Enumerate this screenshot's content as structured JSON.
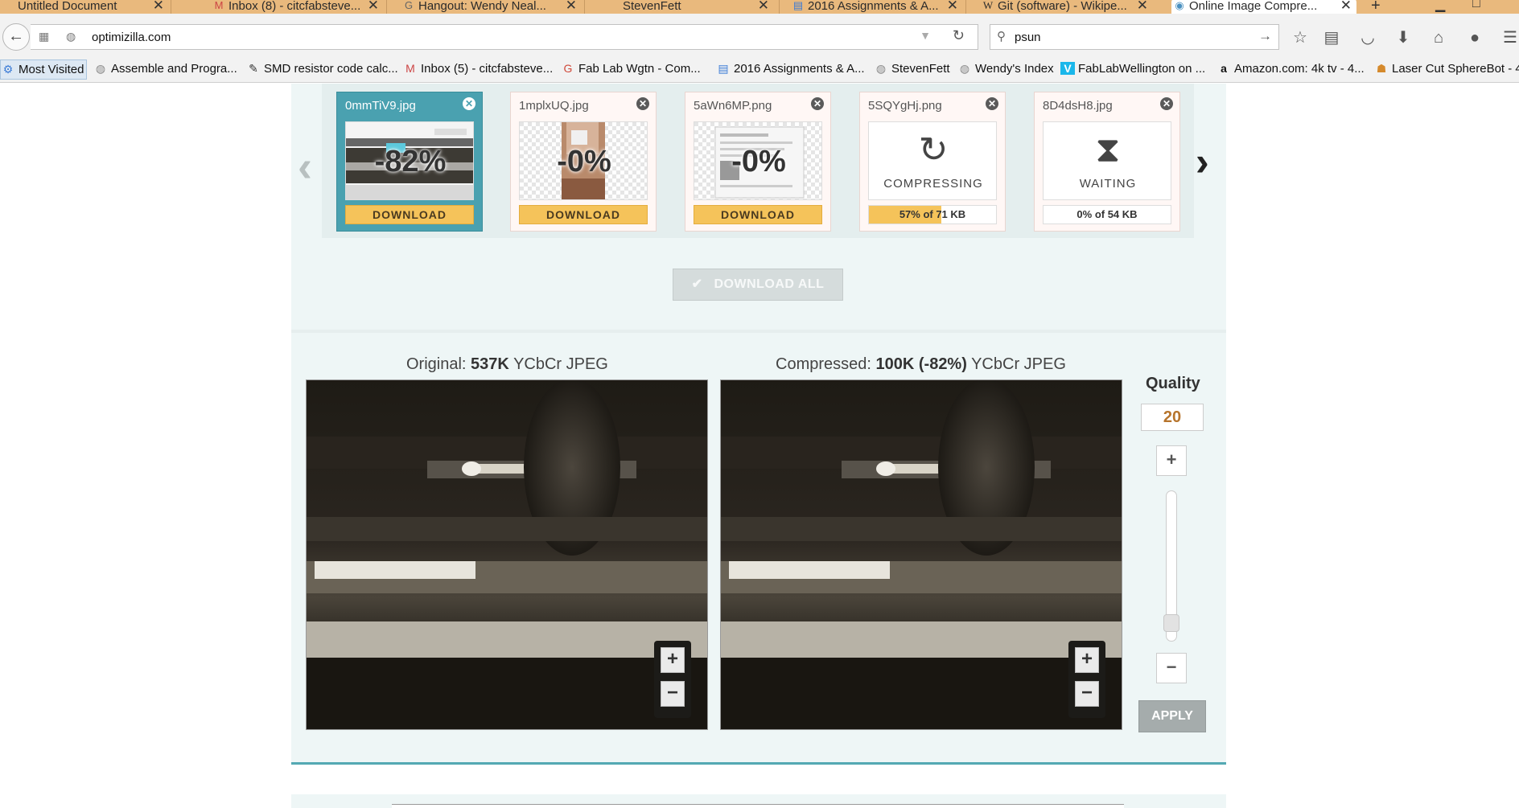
{
  "browser": {
    "tabs": [
      {
        "title": "Untitled Document",
        "icon": "document-icon",
        "active": false
      },
      {
        "title": "Inbox (8) - citcfabsteve...",
        "icon": "gmail-icon",
        "active": false
      },
      {
        "title": "Hangout: Wendy Neal...",
        "icon": "google-icon",
        "active": false
      },
      {
        "title": "StevenFett",
        "icon": "page-icon",
        "active": false
      },
      {
        "title": "2016 Assignments & A...",
        "icon": "docs-icon",
        "active": false
      },
      {
        "title": "Git (software) - Wikipe...",
        "icon": "wikipedia-icon",
        "active": false
      },
      {
        "title": "Online Image Compre...",
        "icon": "globe-icon",
        "active": true
      }
    ],
    "url": "optimizilla.com",
    "search_value": "psun",
    "bookmarks": [
      {
        "label": "Most Visited",
        "icon": "gear-icon"
      },
      {
        "label": "Assemble and Progra...",
        "icon": "globe-icon"
      },
      {
        "label": "SMD resistor code calc...",
        "icon": "tool-icon"
      },
      {
        "label": "Inbox (5) - citcfabsteve...",
        "icon": "gmail-icon"
      },
      {
        "label": "Fab Lab Wgtn - Com...",
        "icon": "google-plus-icon"
      },
      {
        "label": "2016 Assignments & A...",
        "icon": "docs-icon"
      },
      {
        "label": "StevenFett",
        "icon": "globe-icon"
      },
      {
        "label": "Wendy's Index",
        "icon": "globe-icon"
      },
      {
        "label": "FabLabWellington on ...",
        "icon": "vimeo-icon"
      },
      {
        "label": "Amazon.com: 4k tv - 4...",
        "icon": "amazon-icon"
      },
      {
        "label": "Laser Cut SphereBot - 4",
        "icon": "instructables-icon"
      }
    ]
  },
  "carousel": {
    "cards": [
      {
        "name": "0mmTiV9.jpg",
        "percent": "-82%",
        "action": "DOWNLOAD",
        "state": "done"
      },
      {
        "name": "1mplxUQ.jpg",
        "percent": "-0%",
        "action": "DOWNLOAD",
        "state": "done"
      },
      {
        "name": "5aWn6MP.png",
        "percent": "-0%",
        "action": "DOWNLOAD",
        "state": "done"
      },
      {
        "name": "5SQYgHj.png",
        "status": "COMPRESSING",
        "progress_text": "57% of 71 KB",
        "progress": 0.57,
        "state": "compressing"
      },
      {
        "name": "8D4dsH8.jpg",
        "status": "WAITING",
        "progress_text": "0% of 54 KB",
        "progress": 0.0,
        "state": "waiting"
      }
    ],
    "download_all": "DOWNLOAD ALL"
  },
  "compare": {
    "original": {
      "prefix": "Original:",
      "size": "537K",
      "format": "YCbCr JPEG"
    },
    "compressed": {
      "prefix": "Compressed:",
      "size": "100K (-82%)",
      "format": "YCbCr JPEG"
    }
  },
  "quality": {
    "label": "Quality",
    "value": "20",
    "slider_level": 0.2,
    "apply": "APPLY"
  },
  "colors": {
    "accent": "#4aa1b0",
    "download": "#f5c35a",
    "quality_value": "#b6742c"
  }
}
